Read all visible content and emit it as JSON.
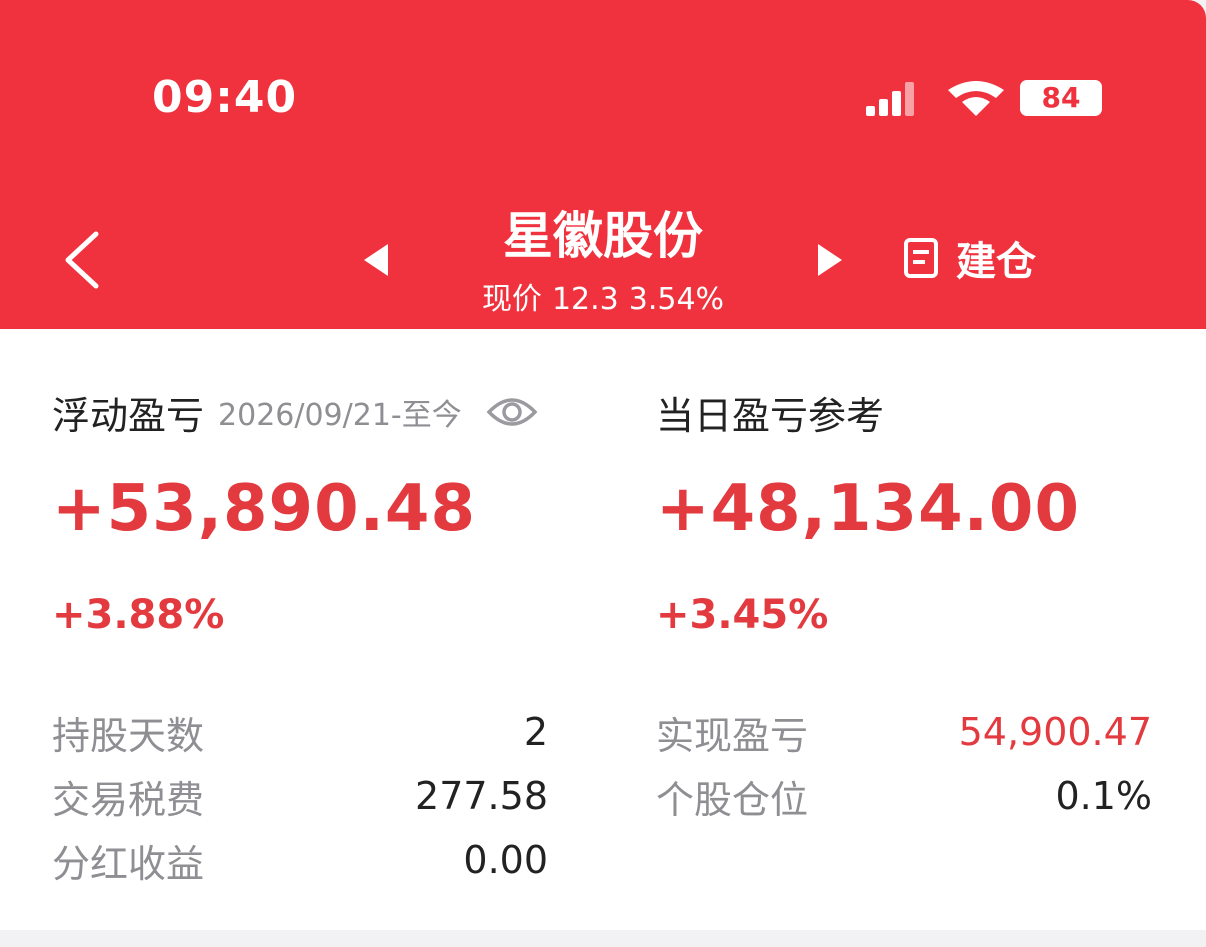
{
  "status_bar": {
    "time": "09:40",
    "battery": "84"
  },
  "header": {
    "stock_name": "星徽股份",
    "price_label": "现价",
    "price": "12.3",
    "change_pct": "3.54%",
    "build_position_label": "建仓"
  },
  "floating_pl": {
    "title": "浮动盈亏",
    "date_range": "2026/09/21-至今",
    "amount": "+53,890.48",
    "percent": "+3.88%",
    "rows": [
      {
        "label": "持股天数",
        "value": "2"
      },
      {
        "label": "交易税费",
        "value": "277.58"
      },
      {
        "label": "分红收益",
        "value": "0.00"
      }
    ]
  },
  "daily_pl": {
    "title": "当日盈亏参考",
    "amount": "+48,134.00",
    "percent": "+3.45%",
    "rows": [
      {
        "label": "实现盈亏",
        "value": "54,900.47"
      },
      {
        "label": "个股仓位",
        "value": "0.1%"
      }
    ]
  },
  "colors": {
    "header_bg": "#ef323d",
    "profit_red": "#e23a3f",
    "label_gray": "#8e8e93",
    "text_dark": "#222222"
  }
}
